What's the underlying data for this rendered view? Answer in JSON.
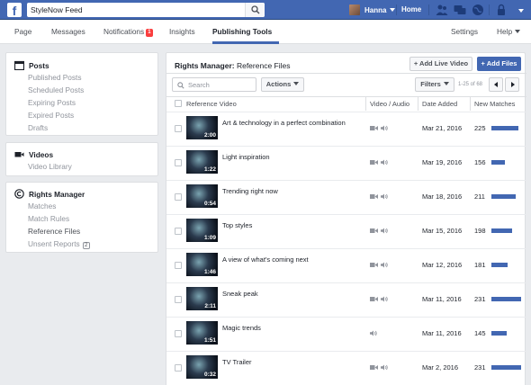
{
  "topbar": {
    "search_value": "StyleNow Feed",
    "user_name": "Hanna",
    "home_label": "Home",
    "brand_color": "#4267b2"
  },
  "nav": {
    "tabs": [
      {
        "label": "Page"
      },
      {
        "label": "Messages"
      },
      {
        "label": "Notifications",
        "badge": "1"
      },
      {
        "label": "Insights"
      },
      {
        "label": "Publishing Tools",
        "active": true
      },
      {
        "label": "Settings"
      },
      {
        "label": "Help"
      }
    ]
  },
  "sidebar": {
    "posts": {
      "title": "Posts",
      "items": [
        "Published Posts",
        "Scheduled Posts",
        "Expiring Posts",
        "Expired Posts",
        "Drafts"
      ]
    },
    "videos": {
      "title": "Videos",
      "items": [
        "Video Library"
      ]
    },
    "rights": {
      "title": "Rights Manager",
      "items": [
        "Matches",
        "Match Rules",
        "Reference Files",
        "Unsent Reports"
      ],
      "unsent_badge": "2"
    }
  },
  "main": {
    "title_bold": "Rights Manager:",
    "title_rest": " Reference Files",
    "add_live_label": "+ Add Live Video",
    "add_files_label": "+ Add Files",
    "search_placeholder": "Search",
    "actions_label": "Actions",
    "filters_label": "Filters",
    "pager_text": "1-25 of 68",
    "columns": {
      "video": "Reference Video",
      "media": "Video / Audio",
      "date": "Date Added",
      "matches": "New Matches"
    },
    "rows": [
      {
        "title": "Art & technology in a perfect combination",
        "duration": "2:00",
        "date": "Mar 21, 2016",
        "matches": "225",
        "bar_fraction": 0.9,
        "video": true
      },
      {
        "title": "Light inspiration",
        "duration": "1:22",
        "date": "Mar 19, 2016",
        "matches": "156",
        "bar_fraction": 0.45,
        "video": true
      },
      {
        "title": "Trending right now",
        "duration": "0:54",
        "date": "Mar 18, 2016",
        "matches": "211",
        "bar_fraction": 0.82,
        "video": true
      },
      {
        "title": "Top styles",
        "duration": "1:09",
        "date": "Mar 15, 2016",
        "matches": "198",
        "bar_fraction": 0.7,
        "video": true
      },
      {
        "title": "A view of what's coming next",
        "duration": "1:46",
        "date": "Mar 12, 2016",
        "matches": "181",
        "bar_fraction": 0.55,
        "video": true
      },
      {
        "title": "Sneak peak",
        "duration": "2:11",
        "date": "Mar 11, 2016",
        "matches": "231",
        "bar_fraction": 1.0,
        "video": true
      },
      {
        "title": "Magic trends",
        "duration": "1:51",
        "date": "Mar 11, 2016",
        "matches": "145",
        "bar_fraction": 0.5,
        "video": false
      },
      {
        "title": "TV Trailer",
        "duration": "0:32",
        "date": "Mar 2, 2016",
        "matches": "231",
        "bar_fraction": 1.0,
        "video": true
      }
    ]
  }
}
